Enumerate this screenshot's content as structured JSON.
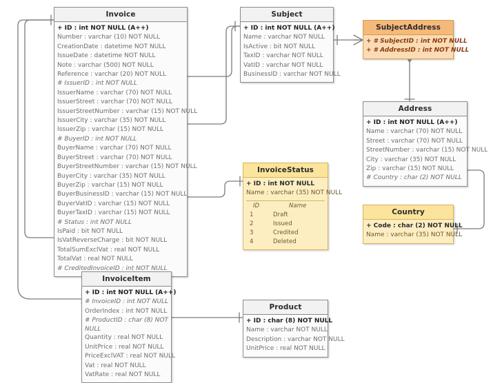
{
  "diagram": {
    "type": "entity-relationship-diagram",
    "notation": "crows-foot",
    "background": "#ffffff",
    "colors": {
      "default_fill": "#fbfbfb",
      "default_header": "#f2f2f2",
      "border": "#8a8a8a",
      "accent_fill": "#fbdcb4",
      "accent_header": "#f5b97a",
      "accent_border": "#d39a4e",
      "accent_text": "#8a3b10",
      "lookup_fill": "#fdeec2",
      "lookup_header": "#fbe49b",
      "lookup_border": "#d6b45e",
      "line": "#7a7a7a"
    }
  },
  "entities": {
    "invoice": {
      "name": "Invoice",
      "style": "default",
      "attributes": [
        {
          "text": "+ ID : int NOT NULL  (A++)",
          "kind": "pk"
        },
        {
          "text": "Number : varchar (10)  NOT NULL",
          "kind": "plain"
        },
        {
          "text": "CreationDate : datetime NOT NULL",
          "kind": "plain"
        },
        {
          "text": "IssueDate : datetime NOT NULL",
          "kind": "plain"
        },
        {
          "text": "Note : varchar (500)  NOT NULL",
          "kind": "plain"
        },
        {
          "text": "Reference : varchar (20)  NOT NULL",
          "kind": "plain"
        },
        {
          "text": "# IssuerID : int NOT NULL",
          "kind": "fk"
        },
        {
          "text": "IssuerName : varchar (70)  NOT NULL",
          "kind": "plain"
        },
        {
          "text": "IssuerStreet : varchar (70)  NOT NULL",
          "kind": "plain"
        },
        {
          "text": "IssuerStreetNumber : varchar (15)  NOT NULL",
          "kind": "plain"
        },
        {
          "text": "IssuerCity : varchar (35)  NOT NULL",
          "kind": "plain"
        },
        {
          "text": "IssuerZip : varchar (15)  NOT NULL",
          "kind": "plain"
        },
        {
          "text": "# BuyerID : int NOT NULL",
          "kind": "fk"
        },
        {
          "text": "BuyerName : varchar (70)  NOT NULL",
          "kind": "plain"
        },
        {
          "text": "BuyerStreet : varchar (70)  NOT NULL",
          "kind": "plain"
        },
        {
          "text": "BuyerStreetNumber : varchar (15)  NOT NULL",
          "kind": "plain"
        },
        {
          "text": "BuyerCity : varchar (35)  NOT NULL",
          "kind": "plain"
        },
        {
          "text": "BuyerZip : varchar (15)  NOT NULL",
          "kind": "plain"
        },
        {
          "text": "BuyerBusinessID : varchar (15)  NOT NULL",
          "kind": "plain"
        },
        {
          "text": "BuyerVatID : varchar (15)  NOT NULL",
          "kind": "plain"
        },
        {
          "text": "BuyerTaxID : varchar (15)  NOT NULL",
          "kind": "plain"
        },
        {
          "text": "# Status : int NOT NULL",
          "kind": "fk"
        },
        {
          "text": "IsPaid : bit NOT NULL",
          "kind": "plain"
        },
        {
          "text": "IsVatReverseCharge : bit NOT NULL",
          "kind": "plain"
        },
        {
          "text": "TotalSumExclVat : real NOT NULL",
          "kind": "plain"
        },
        {
          "text": "TotalVat : real NOT NULL",
          "kind": "plain"
        },
        {
          "text": "# CreditedInvoiceID : int NOT NULL",
          "kind": "fk"
        }
      ]
    },
    "subject": {
      "name": "Subject",
      "style": "default",
      "attributes": [
        {
          "text": "+ ID : int NOT NULL  (A++)",
          "kind": "pk"
        },
        {
          "text": "Name : varchar NOT NULL",
          "kind": "plain"
        },
        {
          "text": "IsActive : bit NOT NULL",
          "kind": "plain"
        },
        {
          "text": "TaxID : varchar NOT NULL",
          "kind": "plain"
        },
        {
          "text": "VatID : varchar NOT NULL",
          "kind": "plain"
        },
        {
          "text": "BusinessID : varchar NOT NULL",
          "kind": "plain"
        }
      ]
    },
    "subject_address": {
      "name": "SubjectAddress",
      "style": "accent",
      "attributes": [
        {
          "text": "+ # SubjectID : int NOT NULL",
          "kind": "pkfk"
        },
        {
          "text": "+ # AddressID : int NOT NULL",
          "kind": "pkfk"
        }
      ]
    },
    "address": {
      "name": "Address",
      "style": "default",
      "attributes": [
        {
          "text": "+ ID : int NOT NULL  (A++)",
          "kind": "pk"
        },
        {
          "text": "Name : varchar (70)  NOT NULL",
          "kind": "plain"
        },
        {
          "text": "Street : varchar (70)  NOT NULL",
          "kind": "plain"
        },
        {
          "text": "StreetNumber : varchar (15)  NOT NULL",
          "kind": "plain"
        },
        {
          "text": "City : varchar (35)  NOT NULL",
          "kind": "plain"
        },
        {
          "text": "Zip : varchar (15)  NOT NULL",
          "kind": "plain"
        },
        {
          "text": "# Country : char (2)  NOT NULL",
          "kind": "fk"
        }
      ]
    },
    "country": {
      "name": "Country",
      "style": "lookup",
      "attributes": [
        {
          "text": "+ Code : char (2)  NOT NULL",
          "kind": "pk"
        },
        {
          "text": "Name : varchar (35)  NOT NULL",
          "kind": "plain"
        }
      ]
    },
    "invoice_status": {
      "name": "InvoiceStatus",
      "style": "lookup",
      "attributes": [
        {
          "text": "+ ID : int NOT NULL",
          "kind": "pk"
        },
        {
          "text": "Name : varchar (35)  NOT NULL",
          "kind": "plain"
        }
      ],
      "grid": {
        "columns": [
          "ID",
          "Name"
        ],
        "rows": [
          {
            "id": "1",
            "name": "Draft"
          },
          {
            "id": "2",
            "name": "Issued"
          },
          {
            "id": "3",
            "name": "Credited"
          },
          {
            "id": "4",
            "name": "Deleted"
          }
        ]
      }
    },
    "invoice_item": {
      "name": "InvoiceItem",
      "style": "default",
      "attributes": [
        {
          "text": "+ ID : int NOT NULL  (A++)",
          "kind": "pk"
        },
        {
          "text": "# InvoiceID : int NOT NULL",
          "kind": "fk"
        },
        {
          "text": "OrderIndex : int NOT NULL",
          "kind": "plain"
        },
        {
          "text": "# ProductID : char (8)  NOT NULL",
          "kind": "fk-wrap"
        },
        {
          "text": "Quantity : real NOT NULL",
          "kind": "plain"
        },
        {
          "text": "UnitPrice : real NOT NULL",
          "kind": "plain"
        },
        {
          "text": "PriceExclVAT : real NOT NULL",
          "kind": "plain"
        },
        {
          "text": "Vat : real NOT NULL",
          "kind": "plain"
        },
        {
          "text": "VatRate : real NOT NULL",
          "kind": "plain"
        }
      ]
    },
    "product": {
      "name": "Product",
      "style": "default",
      "attributes": [
        {
          "text": "+ ID : char (8)  NOT NULL",
          "kind": "pk"
        },
        {
          "text": "Name : varchar NOT NULL",
          "kind": "plain"
        },
        {
          "text": "Description : varchar NOT NULL",
          "kind": "plain"
        },
        {
          "text": "UnitPrice : real NOT NULL",
          "kind": "plain"
        }
      ]
    }
  },
  "relationships": [
    {
      "from": "Invoice.IssuerID",
      "to": "Subject.ID",
      "from_card": "many",
      "to_card": "one"
    },
    {
      "from": "Invoice.BuyerID",
      "to": "Subject.ID",
      "from_card": "many",
      "to_card": "one"
    },
    {
      "from": "Invoice.Status",
      "to": "InvoiceStatus.ID",
      "from_card": "many",
      "to_card": "one"
    },
    {
      "from": "Invoice.CreditedInvoiceID",
      "to": "Invoice.ID",
      "from_card": "many",
      "to_card": "one"
    },
    {
      "from": "InvoiceItem.InvoiceID",
      "to": "Invoice.ID",
      "from_card": "many",
      "to_card": "one"
    },
    {
      "from": "InvoiceItem.ProductID",
      "to": "Product.ID",
      "from_card": "many",
      "to_card": "one"
    },
    {
      "from": "SubjectAddress.SubjectID",
      "to": "Subject.ID",
      "from_card": "many",
      "to_card": "one"
    },
    {
      "from": "SubjectAddress.AddressID",
      "to": "Address.ID",
      "from_card": "many",
      "to_card": "one"
    },
    {
      "from": "Address.Country",
      "to": "Country.Code",
      "from_card": "many",
      "to_card": "one"
    }
  ]
}
